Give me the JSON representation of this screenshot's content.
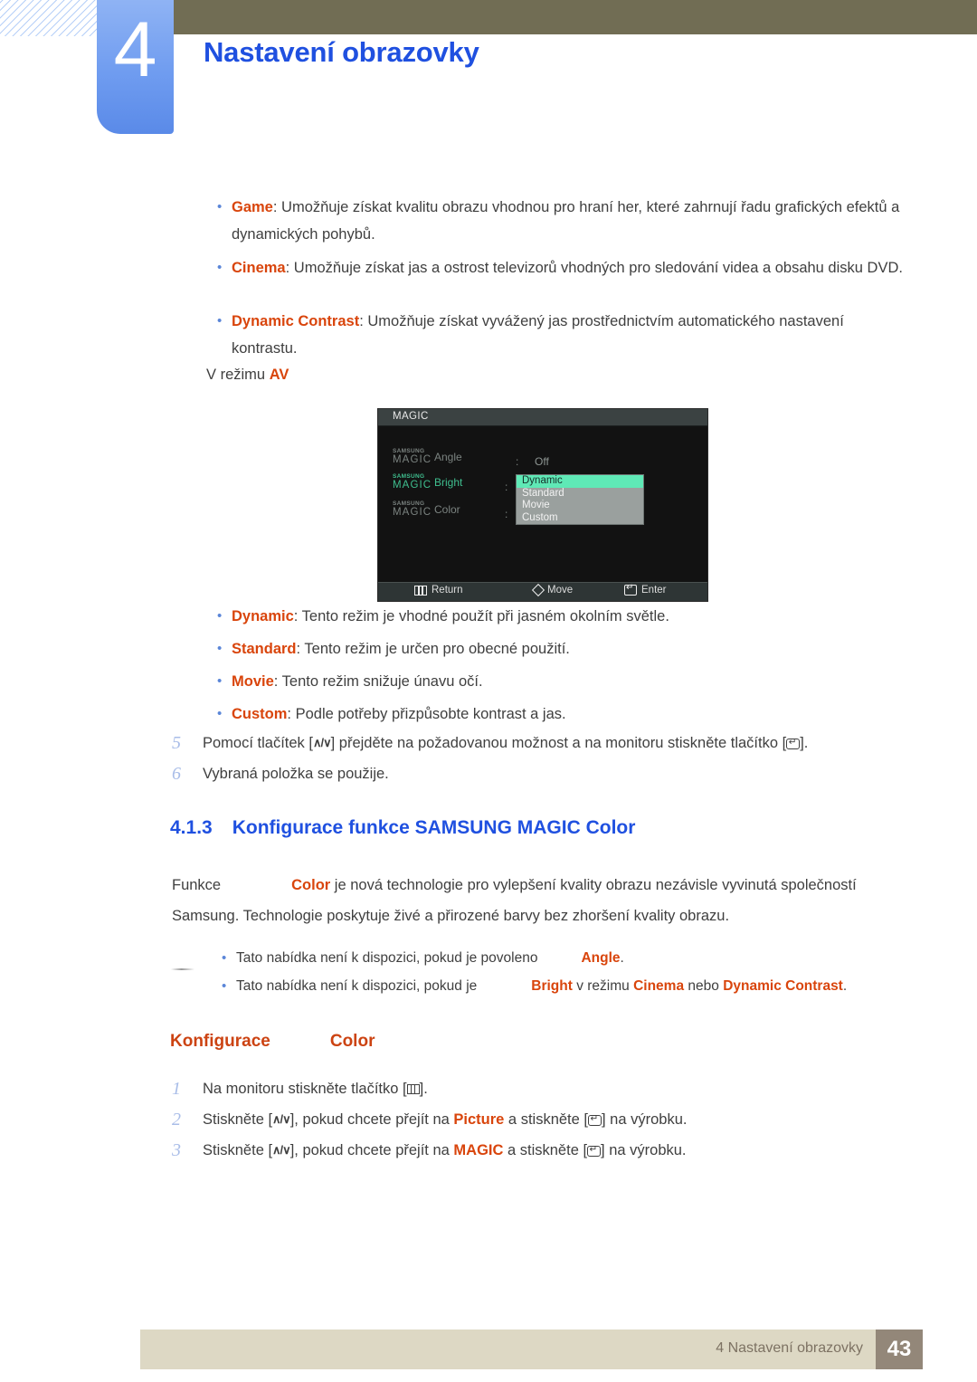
{
  "header": {
    "chapter_number": "4",
    "chapter_title": "Nastavení obrazovky"
  },
  "mode_list": {
    "items": [
      {
        "term": "Game",
        "desc": ": Umožňuje získat kvalitu obrazu vhodnou pro hraní her, které zahrnují řadu grafických efektů a dynamických pohybů."
      },
      {
        "term": "Cinema",
        "desc": ": Umožňuje získat jas a ostrost televizorů vhodných pro sledování videa a obsahu disku DVD."
      },
      {
        "term": "Dynamic Contrast",
        "desc": ": Umožňuje získat vyvážený jas prostřednictvím automatického nastavení kontrastu."
      }
    ]
  },
  "av_line": {
    "prefix": "V režimu ",
    "keyword": "AV"
  },
  "osd": {
    "title": "MAGIC",
    "brand_top": "SAMSUNG",
    "brand_bottom": "MAGIC",
    "rows": [
      {
        "label": "Angle",
        "colon": ":",
        "value": "Off",
        "state": "dim"
      },
      {
        "label": "Bright",
        "colon": ":",
        "value": "",
        "state": "on"
      },
      {
        "label": "Color",
        "colon": ":",
        "value": "",
        "state": "dim"
      }
    ],
    "dropdown": {
      "options": [
        "Dynamic",
        "Standard",
        "Movie",
        "Custom"
      ],
      "selected_index": 0
    },
    "footer": [
      {
        "icon": "menu-icon",
        "label": "Return"
      },
      {
        "icon": "diamond-move-icon",
        "label": "Move"
      },
      {
        "icon": "enter-icon",
        "label": "Enter"
      }
    ],
    "colors": {
      "highlight": "#5fe9b6",
      "active_label": "#3fbf8f",
      "dim_label": "#7b8380",
      "dropdown_bg": "#9aa09e"
    }
  },
  "preset_list": {
    "items": [
      {
        "term": "Dynamic",
        "desc": ": Tento režim je vhodné použít při jasném okolním světle."
      },
      {
        "term": "Standard",
        "desc": ": Tento režim je určen pro obecné použití."
      },
      {
        "term": "Movie",
        "desc": ": Tento režim snižuje únavu očí."
      },
      {
        "term": "Custom",
        "desc": ": Podle potřeby přizpůsobte kontrast a jas."
      }
    ]
  },
  "steps_top": [
    {
      "num": "5",
      "part1": "Pomocí tlačítek [",
      "key1": "∧/∨",
      "part2": "] přejděte na požadovanou možnost a na monitoru stiskněte tlačítko [",
      "part3": "]."
    },
    {
      "num": "6",
      "part1": "Vybraná položka se použije.",
      "part2": "",
      "part3": ""
    }
  ],
  "section": {
    "number": "4.1.3",
    "title": "Konfigurace funkce SAMSUNG MAGIC Color"
  },
  "intro_paragraph": {
    "line1_prefix": "Funkce",
    "line1_keyword": "Color",
    "line1_rest": " je nová technologie pro vylepšení kvality obrazu nezávisle vyvinutá společností",
    "line2": "Samsung. Technologie poskytuje živé a přirozené barvy bez zhoršení kvality obrazu."
  },
  "notes": [
    {
      "text_before": "Tato nabídka není k dispozici, pokud je povoleno",
      "keyword1": "Angle",
      "mid1": ".",
      "keyword2": "",
      "mid2": "",
      "keyword3": "",
      "end": ""
    },
    {
      "text_before": "Tato nabídka není k dispozici, pokud je",
      "keyword1": "Bright",
      "mid1": " v režimu ",
      "keyword2": "Cinema",
      "mid2": " nebo ",
      "keyword3": "Dynamic Contrast",
      "end": "."
    }
  ],
  "config_heading": {
    "left": "Konfigurace",
    "right": "Color"
  },
  "steps_bottom": [
    {
      "num": "1",
      "part1": "Na monitoru stiskněte tlačítko [",
      "part2": "]."
    },
    {
      "num": "2",
      "p_a": "Stiskněte [",
      "key": "∧/∨",
      "p_b": "], pokud chcete přejít na ",
      "kw": "Picture",
      "p_c": " a stiskněte [",
      "p_d": "] na výrobku."
    },
    {
      "num": "3",
      "p_a": "Stiskněte [",
      "key": "∧/∨",
      "p_b": "], pokud chcete přejít na ",
      "kw": "MAGIC",
      "p_c": " a stiskněte [",
      "p_d": "] na výrobku."
    }
  ],
  "footer": {
    "text": "4 Nastavení obrazovky",
    "page": "43"
  },
  "theme": {
    "accent_orange": "#d9450c",
    "heading_blue": "#1f50e0",
    "olive": "#716d54",
    "footer_bar": "#ddd8c4",
    "footer_box": "#938779"
  }
}
